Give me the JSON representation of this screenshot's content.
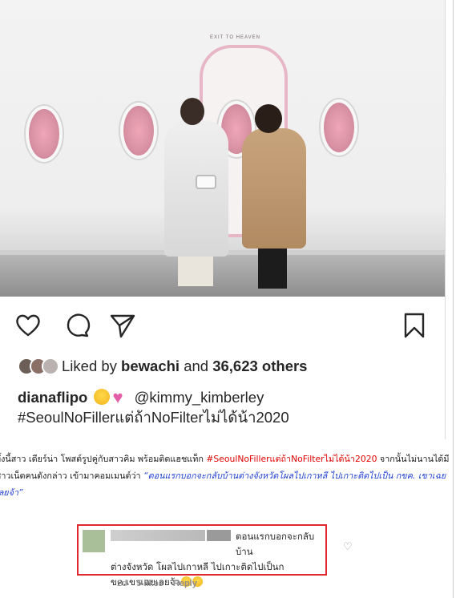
{
  "photo": {
    "sign_text": "EXIT TO HEAVEN",
    "description_colors": {
      "window": "#d891a3",
      "door_frame": "#e7b7c7"
    }
  },
  "actions": {
    "icons": [
      "heart-icon",
      "comment-icon",
      "share-icon",
      "bookmark-icon"
    ]
  },
  "likes": {
    "prefix": "Liked by",
    "user": "bewachi",
    "joiner": "and",
    "count": "36,623 others"
  },
  "caption": {
    "username": "dianaflipo",
    "mention": "@kimmy_kimberley",
    "hashtag": "#SeoulNoFillerแต่ถ้าNoFilterไม่ได้น้า2020"
  },
  "article": {
    "part1": "ทั้งนี้สาว เดียร์น่า โพสต์รูปคู่กับสาวคิม พร้อมติดแฮชแท็ก ",
    "hashtag": "#SeoulNoFillerแต่ถ้าNoFilterไม่ได้น้า2020",
    "part2": " จากนั้นไม่นานได้มีชาวเน็ตคนดังกล่าว เข้ามาคอมเมนต์ว่า ",
    "quote": "“ตอนแรกบอกจะกลับบ้านต่างจังหวัดโผลไปเกาหลี ไปเกาะติดไปเป็น กขค. เขาเฉยเลยจ้า”",
    "accent_red": "#e00000",
    "accent_blue": "#1f3fd0"
  },
  "comment": {
    "line1": "ตอนแรกบอกจะกลับบ้าน",
    "line2": "ต่างจังหวัด โผลไปเกาหลี ไปเกาะติดไปเป็นก",
    "line3": "ขค.เขาเฉยเลยจ้า",
    "time": "2d",
    "likes": "5 likes",
    "reply": "Reply",
    "highlight_color": "#e0292f"
  }
}
